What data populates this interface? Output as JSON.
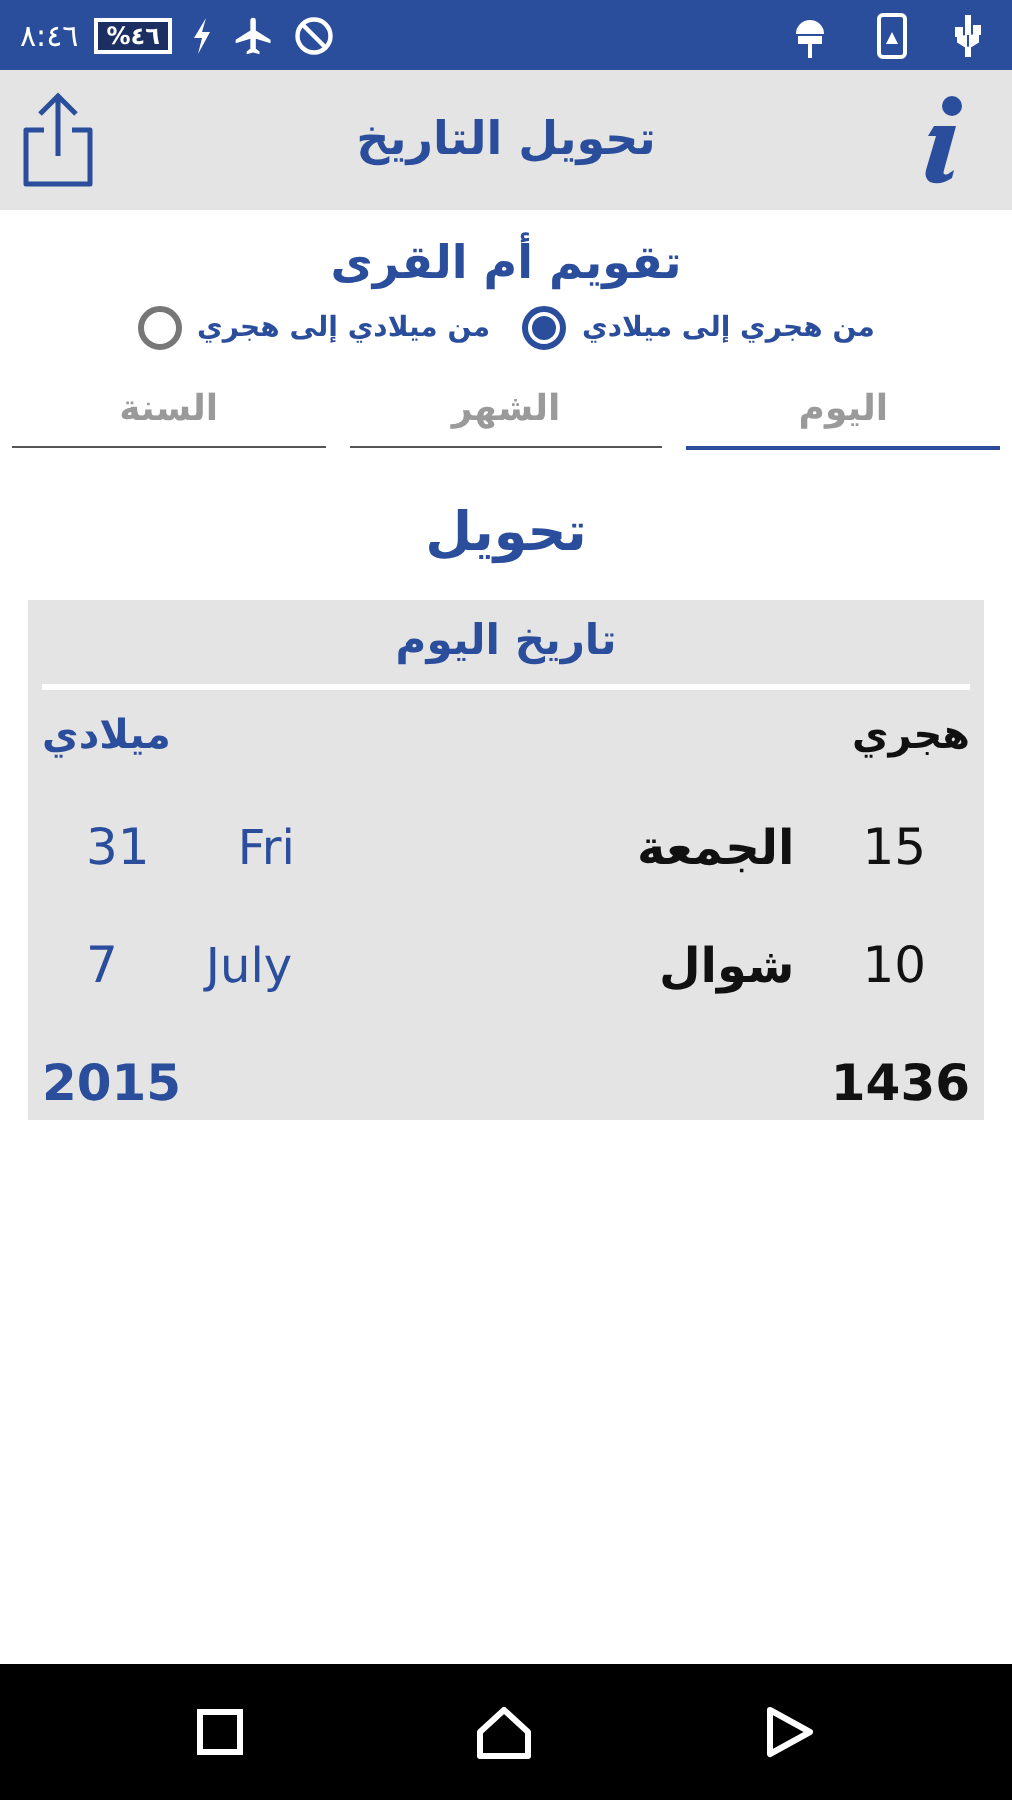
{
  "status_bar": {
    "time": "٨:٤٦",
    "battery": "%٤٦"
  },
  "app_bar": {
    "title": "تحويل التاريخ"
  },
  "calendar_title": "تقويم أم القرى",
  "directions": [
    {
      "label": "من هجري إلى ميلادي",
      "selected": true
    },
    {
      "label": "من ميلادي إلى هجري",
      "selected": false
    }
  ],
  "fields": [
    {
      "placeholder": "اليوم",
      "focused": true
    },
    {
      "placeholder": "الشهر",
      "focused": false
    },
    {
      "placeholder": "السنة",
      "focused": false
    }
  ],
  "convert_button": "تحويل",
  "today_card": {
    "title": "تاريخ اليوم",
    "hijri": {
      "label": "هجري",
      "day": "15",
      "weekday": "الجمعة",
      "month": "10",
      "month_name": "شوال",
      "year": "1436"
    },
    "gregorian": {
      "label": "ميلادي",
      "day": "31",
      "weekday": "Fri",
      "month": "7",
      "month_name": "July",
      "year": "2015"
    }
  }
}
